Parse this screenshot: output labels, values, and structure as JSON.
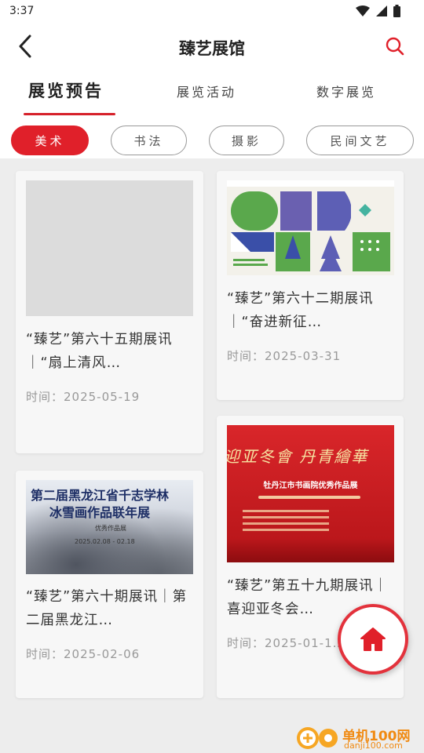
{
  "status_bar": {
    "time": "3:37"
  },
  "header": {
    "title": "臻艺展馆"
  },
  "tabs": [
    {
      "label": "展览预告",
      "active": true
    },
    {
      "label": "展览活动",
      "active": false
    },
    {
      "label": "数字展览",
      "active": false
    }
  ],
  "filters": [
    {
      "label": "美术",
      "active": true
    },
    {
      "label": "书法",
      "active": false
    },
    {
      "label": "摄影",
      "active": false
    },
    {
      "label": "民间文艺",
      "active": false
    }
  ],
  "cards": [
    {
      "title": "“臻艺”第六十五期展讯｜“扇上清风…",
      "time": "时间：2025-05-19"
    },
    {
      "title": "“臻艺”第六十二期展讯｜“奋进新征…",
      "time": "时间：2025-03-31"
    },
    {
      "title": "“臻艺”第六十期展讯｜第二届黑龙江…",
      "time": "时间：2025-02-06",
      "image_text": {
        "line1": "第二届黑龙江省千志学林",
        "line2": "冰雪画作品联年展",
        "subtitle": "优秀作品展",
        "dates": "2025.02.08 - 02.18"
      }
    },
    {
      "title": "“臻艺”第五十九期展讯｜喜迎亚冬会…",
      "time": "时间：2025-01-1…",
      "image_text": {
        "banner": "迎亚冬會 丹青繪華",
        "title": "牡丹江市书画院优秀作品展"
      }
    }
  ],
  "watermark": {
    "name": "单机100网",
    "url": "danji100.com"
  },
  "colors": {
    "accent": "#e0202a",
    "background": "#ededed"
  },
  "icons": {
    "back": "back-arrow-icon",
    "search": "search-icon",
    "home": "home-icon"
  }
}
